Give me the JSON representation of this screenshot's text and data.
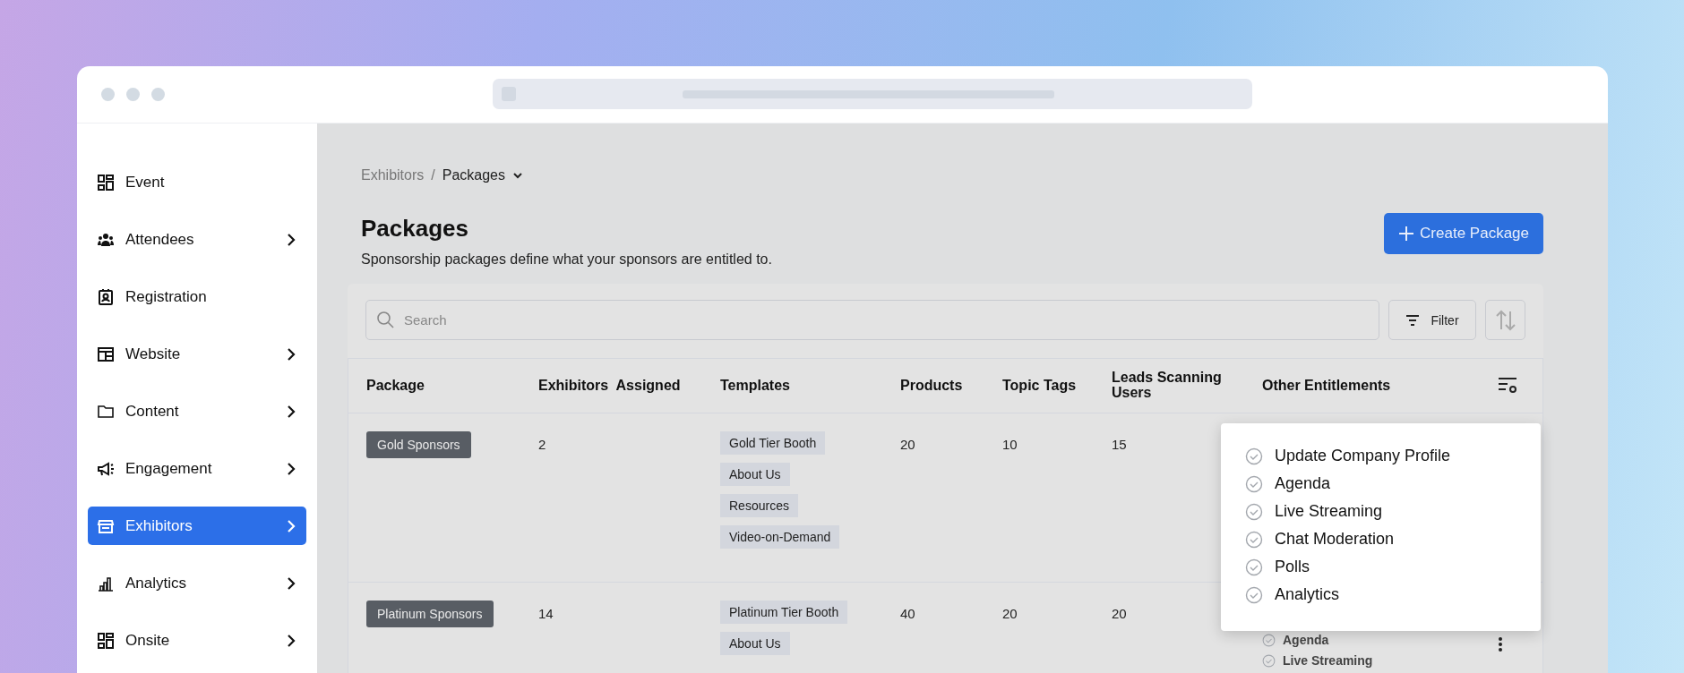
{
  "sidebar": {
    "items": [
      {
        "label": "Event",
        "has_submenu": false,
        "selected": false
      },
      {
        "label": "Attendees",
        "has_submenu": true,
        "selected": false
      },
      {
        "label": "Registration",
        "has_submenu": false,
        "selected": false
      },
      {
        "label": "Website",
        "has_submenu": true,
        "selected": false
      },
      {
        "label": "Content",
        "has_submenu": true,
        "selected": false
      },
      {
        "label": "Engagement",
        "has_submenu": true,
        "selected": false
      },
      {
        "label": "Exhibitors",
        "has_submenu": true,
        "selected": true
      },
      {
        "label": "Analytics",
        "has_submenu": true,
        "selected": false
      },
      {
        "label": "Onsite",
        "has_submenu": true,
        "selected": false
      }
    ]
  },
  "breadcrumb": {
    "items": [
      "Exhibitors",
      "Packages"
    ],
    "separator": "/"
  },
  "header": {
    "title": "Packages",
    "subtitle": "Sponsorship packages define what your sponsors are entitled to.",
    "create_button": "Create Package"
  },
  "toolbar": {
    "search_placeholder": "Search",
    "filter_button": "Filter"
  },
  "table": {
    "columns": [
      "Package",
      "Exhibitors  Assigned",
      "Templates",
      "Products",
      "Topic Tags",
      "Leads Scanning Users",
      "Other Entitlements"
    ],
    "rows": [
      {
        "package": "Gold Sponsors",
        "exhibitors_assigned": "2",
        "templates": [
          "Gold Tier Booth",
          "About Us",
          "Resources",
          "Video-on-Demand"
        ],
        "products": "20",
        "topic_tags": "10",
        "leads_scanning_users": "15",
        "other_entitlements": []
      },
      {
        "package": "Platinum Sponsors",
        "exhibitors_assigned": "14",
        "templates": [
          "Platinum Tier Booth",
          "About Us"
        ],
        "products": "40",
        "topic_tags": "20",
        "leads_scanning_users": "20",
        "other_entitlements": [
          "Agenda",
          "Live Streaming"
        ]
      }
    ]
  },
  "popup": {
    "items": [
      "Update Company Profile",
      "Agenda",
      "Live Streaming",
      "Chat Moderation",
      "Polls",
      "Analytics"
    ]
  }
}
